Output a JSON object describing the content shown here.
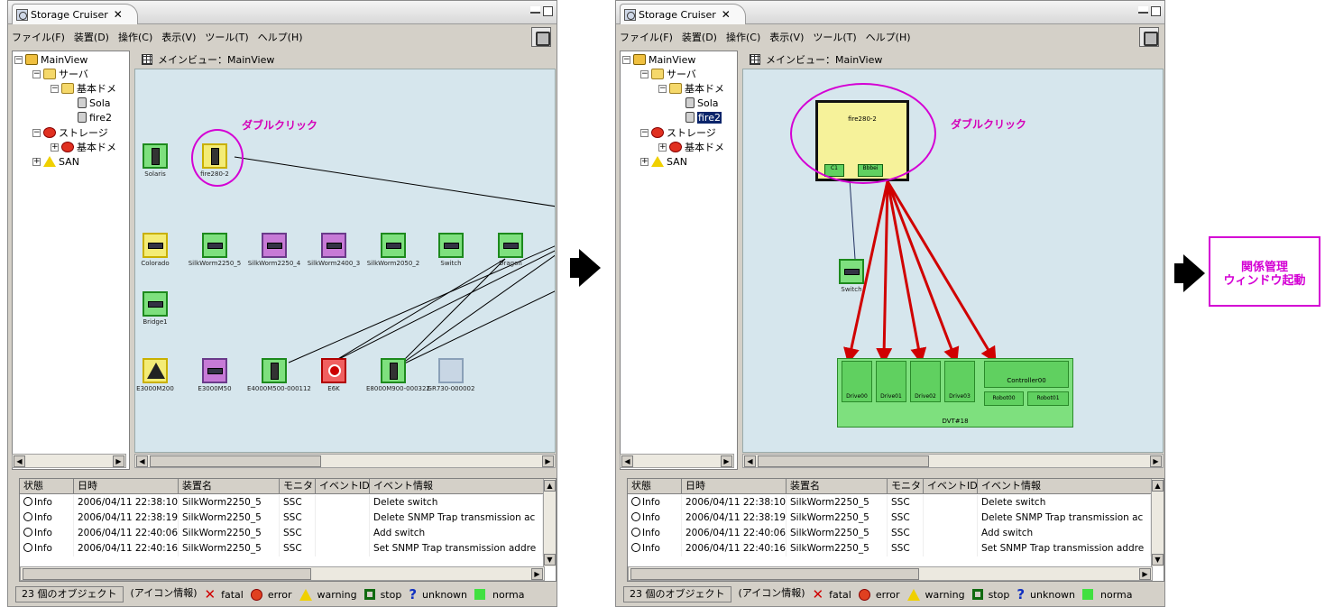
{
  "window": {
    "title": "Storage Cruiser",
    "menus": [
      "ファイル(F)",
      "装置(D)",
      "操作(C)",
      "表示(V)",
      "ツール(T)",
      "ヘルプ(H)"
    ],
    "view_title": "メインビュー：MainView"
  },
  "tree": {
    "root": "MainView",
    "server": "サーバ",
    "domain": "基本ドメ",
    "servers": [
      "Sola",
      "fire2"
    ],
    "storage": "ストレージ",
    "storage_domain": "基本ドメ",
    "san": "SAN"
  },
  "left_view": {
    "annotation": "ダブルクリック",
    "nodes": [
      {
        "label": "Solaris",
        "status": "normal"
      },
      {
        "label": "fire280-2",
        "status": "warning"
      },
      {
        "label": "Colorado",
        "status": "warning"
      },
      {
        "label": "SilkWorm2250_5",
        "status": "normal"
      },
      {
        "label": "SilkWorm2250_4",
        "status": "stop"
      },
      {
        "label": "SilkWorm2400_3",
        "status": "stop"
      },
      {
        "label": "SilkWorm2050_2",
        "status": "normal"
      },
      {
        "label": "Switch",
        "status": "normal"
      },
      {
        "label": "Dragon",
        "status": "normal"
      },
      {
        "label": "Bridge1",
        "status": "normal"
      },
      {
        "label": "E3000M200",
        "status": "warning"
      },
      {
        "label": "E3000M50",
        "status": "stop"
      },
      {
        "label": "E4000M500-000112",
        "status": "normal"
      },
      {
        "label": "E6K",
        "status": "error"
      },
      {
        "label": "E8000M900-000322",
        "status": "normal"
      },
      {
        "label": "GR730-000002",
        "status": "unknown"
      }
    ]
  },
  "right_view": {
    "annotation": "ダブルクリック",
    "host": {
      "label": "fire280-2",
      "ports": [
        "C1",
        "Bbbei"
      ]
    },
    "switch_label": "Switch",
    "drives": [
      "Drive00",
      "Drive01",
      "Drive02",
      "Drive03"
    ],
    "controller": "Controller00",
    "robots": [
      "Robot00",
      "Robot01"
    ],
    "library": "DVT#18"
  },
  "log": {
    "columns": [
      "状態",
      "日時",
      "装置名",
      "モニタ",
      "イベントID",
      "イベント情報"
    ],
    "rows": [
      {
        "status": "Info",
        "time": "2006/04/11 22:38:10",
        "device": "SilkWorm2250_5",
        "monitor": "SSC",
        "event_id": "",
        "info": "Delete switch"
      },
      {
        "status": "Info",
        "time": "2006/04/11 22:38:19",
        "device": "SilkWorm2250_5",
        "monitor": "SSC",
        "event_id": "",
        "info": "Delete SNMP Trap transmission ac"
      },
      {
        "status": "Info",
        "time": "2006/04/11 22:40:06",
        "device": "SilkWorm2250_5",
        "monitor": "SSC",
        "event_id": "",
        "info": "Add switch"
      },
      {
        "status": "Info",
        "time": "2006/04/11 22:40:16",
        "device": "SilkWorm2250_5",
        "monitor": "SSC",
        "event_id": "",
        "info": "Set SNMP Trap transmission addre"
      }
    ]
  },
  "statusbar": {
    "count": "23 個のオブジェクト",
    "icon_info": "(アイコン情報)",
    "fatal": "fatal",
    "error": "error",
    "warning": "warning",
    "stop": "stop",
    "unknown": "unknown",
    "normal": "norma"
  },
  "result": {
    "line1": "関係管理",
    "line2": "ウィンドウ起動"
  },
  "colors": {
    "annotation": "#d400d4",
    "link_red": "#d00000",
    "canvas_bg": "#d6e6ed",
    "node_normal": "#7ee07e"
  }
}
